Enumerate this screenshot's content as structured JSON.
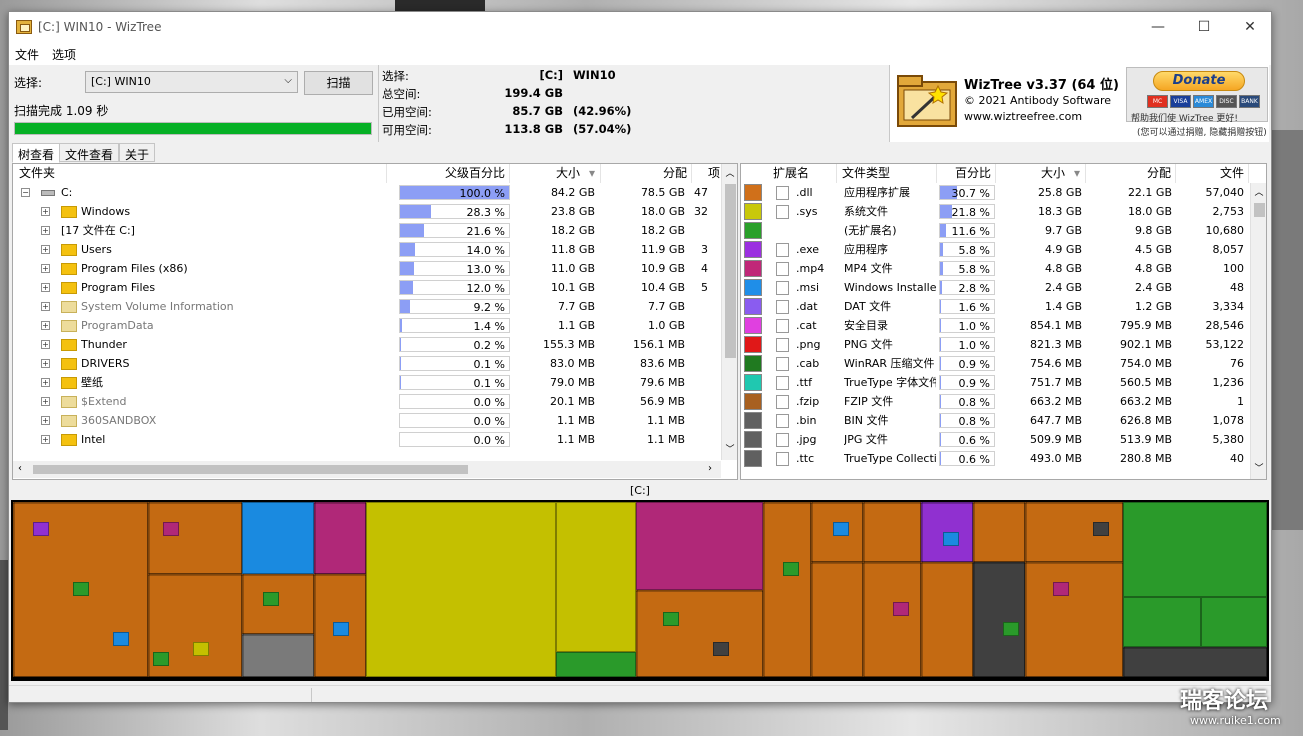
{
  "window": {
    "title": "[C:] WIN10  - WizTree",
    "minimize": "—",
    "maximize": "☐",
    "close": "✕"
  },
  "menu": [
    "文件",
    "选项"
  ],
  "select": {
    "label": "选择:",
    "drive": "[C:] WIN10",
    "scan_button": "扫描",
    "status": "扫描完成 1.09 秒",
    "progress": 1.0
  },
  "info": [
    {
      "key": "选择:",
      "v1": "[C:]",
      "v2": "WIN10"
    },
    {
      "key": "总空间:",
      "v1": "199.4 GB",
      "v2": ""
    },
    {
      "key": "已用空间:",
      "v1": "85.7 GB",
      "v2": "(42.96%)"
    },
    {
      "key": "可用空间:",
      "v1": "113.8 GB",
      "v2": "(57.04%)"
    }
  ],
  "about": {
    "version": "WizTree v3.37 (64 位)",
    "copyright": "© 2021 Antibody Software",
    "website": "www.wiztreefree.com",
    "donate": "Donate",
    "cards": [
      "MC",
      "VISA",
      "AMEX",
      "DISC",
      "BANK"
    ],
    "donate_note": "帮助我们使 WizTree 更好!",
    "donate_note2": "(您可以通过捐赠, 隐藏捐赠按钮)"
  },
  "tabs": [
    "树查看",
    "文件查看",
    "关于"
  ],
  "tree": {
    "headers": {
      "folder": "文件夹",
      "pct": "父级百分比",
      "size": "大小",
      "alloc": "分配",
      "items": "项"
    },
    "rows": [
      {
        "name": "C:",
        "pct": "100.0 %",
        "fill": 1.0,
        "size": "84.2 GB",
        "alloc": "78.5 GB",
        "items": "47",
        "type": "drive",
        "indent": 0,
        "color": "#000"
      },
      {
        "name": "Windows",
        "pct": "28.3 %",
        "fill": 0.283,
        "size": "23.8 GB",
        "alloc": "18.0 GB",
        "items": "32",
        "type": "folder",
        "indent": 1,
        "color": "#000"
      },
      {
        "name": "[17 文件在 C:]",
        "pct": "21.6 %",
        "fill": 0.216,
        "size": "18.2 GB",
        "alloc": "18.2 GB",
        "items": "",
        "type": "none",
        "indent": 1,
        "color": "#000"
      },
      {
        "name": "Users",
        "pct": "14.0 %",
        "fill": 0.14,
        "size": "11.8 GB",
        "alloc": "11.9 GB",
        "items": "3",
        "type": "folder",
        "indent": 1,
        "color": "#000"
      },
      {
        "name": "Program Files (x86)",
        "pct": "13.0 %",
        "fill": 0.13,
        "size": "11.0 GB",
        "alloc": "10.9 GB",
        "items": "4",
        "type": "folder",
        "indent": 1,
        "color": "#000"
      },
      {
        "name": "Program Files",
        "pct": "12.0 %",
        "fill": 0.12,
        "size": "10.1 GB",
        "alloc": "10.4 GB",
        "items": "5",
        "type": "folder",
        "indent": 1,
        "color": "#000"
      },
      {
        "name": "System Volume Information",
        "pct": "9.2 %",
        "fill": 0.092,
        "size": "7.7 GB",
        "alloc": "7.7 GB",
        "items": "",
        "type": "sysfolder",
        "indent": 1,
        "color": "#777"
      },
      {
        "name": "ProgramData",
        "pct": "1.4 %",
        "fill": 0.014,
        "size": "1.1 GB",
        "alloc": "1.0 GB",
        "items": "",
        "type": "sysfolder",
        "indent": 1,
        "color": "#777"
      },
      {
        "name": "Thunder",
        "pct": "0.2 %",
        "fill": 0.002,
        "size": "155.3 MB",
        "alloc": "156.1 MB",
        "items": "",
        "type": "folder",
        "indent": 1,
        "color": "#000"
      },
      {
        "name": "DRIVERS",
        "pct": "0.1 %",
        "fill": 0.001,
        "size": "83.0 MB",
        "alloc": "83.6 MB",
        "items": "",
        "type": "folder",
        "indent": 1,
        "color": "#000"
      },
      {
        "name": "壁纸",
        "pct": "0.1 %",
        "fill": 0.001,
        "size": "79.0 MB",
        "alloc": "79.6 MB",
        "items": "",
        "type": "folder",
        "indent": 1,
        "color": "#000"
      },
      {
        "name": "$Extend",
        "pct": "0.0 %",
        "fill": 0,
        "size": "20.1 MB",
        "alloc": "56.9 MB",
        "items": "",
        "type": "sysfolder",
        "indent": 1,
        "color": "#777"
      },
      {
        "name": "360SANDBOX",
        "pct": "0.0 %",
        "fill": 0,
        "size": "1.1 MB",
        "alloc": "1.1 MB",
        "items": "",
        "type": "sysfolder",
        "indent": 1,
        "color": "#777"
      },
      {
        "name": "Intel",
        "pct": "0.0 %",
        "fill": 0,
        "size": "1.1 MB",
        "alloc": "1.1 MB",
        "items": "",
        "type": "folder",
        "indent": 1,
        "color": "#000"
      }
    ]
  },
  "ext": {
    "headers": {
      "ext": "扩展名",
      "type": "文件类型",
      "pct": "百分比",
      "size": "大小",
      "alloc": "分配",
      "files": "文件"
    },
    "rows": [
      {
        "color": "#d0701a",
        "ext": ".dll",
        "type": "应用程序扩展",
        "pct": "30.7 %",
        "fill": 0.307,
        "size": "25.8 GB",
        "alloc": "22.1 GB",
        "files": "57,040"
      },
      {
        "color": "#c8c80a",
        "ext": ".sys",
        "type": "系统文件",
        "pct": "21.8 %",
        "fill": 0.218,
        "size": "18.3 GB",
        "alloc": "18.0 GB",
        "files": "2,753"
      },
      {
        "color": "#2aa02a",
        "ext": "",
        "type": "(无扩展名)",
        "pct": "11.6 %",
        "fill": 0.116,
        "size": "9.7 GB",
        "alloc": "9.8 GB",
        "files": "10,680"
      },
      {
        "color": "#9b30e0",
        "ext": ".exe",
        "type": "应用程序",
        "pct": "5.8 %",
        "fill": 0.058,
        "size": "4.9 GB",
        "alloc": "4.5 GB",
        "files": "8,057"
      },
      {
        "color": "#c02878",
        "ext": ".mp4",
        "type": "MP4 文件",
        "pct": "5.8 %",
        "fill": 0.058,
        "size": "4.8 GB",
        "alloc": "4.8 GB",
        "files": "100"
      },
      {
        "color": "#1f8ee8",
        "ext": ".msi",
        "type": "Windows Installer",
        "pct": "2.8 %",
        "fill": 0.028,
        "size": "2.4 GB",
        "alloc": "2.4 GB",
        "files": "48"
      },
      {
        "color": "#8a5cf0",
        "ext": ".dat",
        "type": "DAT 文件",
        "pct": "1.6 %",
        "fill": 0.016,
        "size": "1.4 GB",
        "alloc": "1.2 GB",
        "files": "3,334"
      },
      {
        "color": "#e040e0",
        "ext": ".cat",
        "type": "安全目录",
        "pct": "1.0 %",
        "fill": 0.01,
        "size": "854.1 MB",
        "alloc": "795.9 MB",
        "files": "28,546"
      },
      {
        "color": "#e01818",
        "ext": ".png",
        "type": "PNG 文件",
        "pct": "1.0 %",
        "fill": 0.01,
        "size": "821.3 MB",
        "alloc": "902.1 MB",
        "files": "53,122"
      },
      {
        "color": "#207a20",
        "ext": ".cab",
        "type": "WinRAR 压缩文件",
        "pct": "0.9 %",
        "fill": 0.009,
        "size": "754.6 MB",
        "alloc": "754.0 MB",
        "files": "76"
      },
      {
        "color": "#20c8b0",
        "ext": ".ttf",
        "type": "TrueType 字体文件",
        "pct": "0.9 %",
        "fill": 0.009,
        "size": "751.7 MB",
        "alloc": "560.5 MB",
        "files": "1,236"
      },
      {
        "color": "#a86020",
        "ext": ".fzip",
        "type": "FZIP 文件",
        "pct": "0.8 %",
        "fill": 0.008,
        "size": "663.2 MB",
        "alloc": "663.2 MB",
        "files": "1"
      },
      {
        "color": "#606060",
        "ext": ".bin",
        "type": "BIN 文件",
        "pct": "0.8 %",
        "fill": 0.008,
        "size": "647.7 MB",
        "alloc": "626.8 MB",
        "files": "1,078"
      },
      {
        "color": "#606060",
        "ext": ".jpg",
        "type": "JPG 文件",
        "pct": "0.6 %",
        "fill": 0.006,
        "size": "509.9 MB",
        "alloc": "513.9 MB",
        "files": "5,380"
      },
      {
        "color": "#606060",
        "ext": ".ttc",
        "type": "TrueType Collection",
        "pct": "0.6 %",
        "fill": 0.006,
        "size": "493.0 MB",
        "alloc": "280.8 MB",
        "files": "40"
      }
    ]
  },
  "treemap": {
    "title": "[C:]"
  },
  "watermark": {
    "text": "瑞客论坛",
    "sub": "www.ruike1.com"
  }
}
